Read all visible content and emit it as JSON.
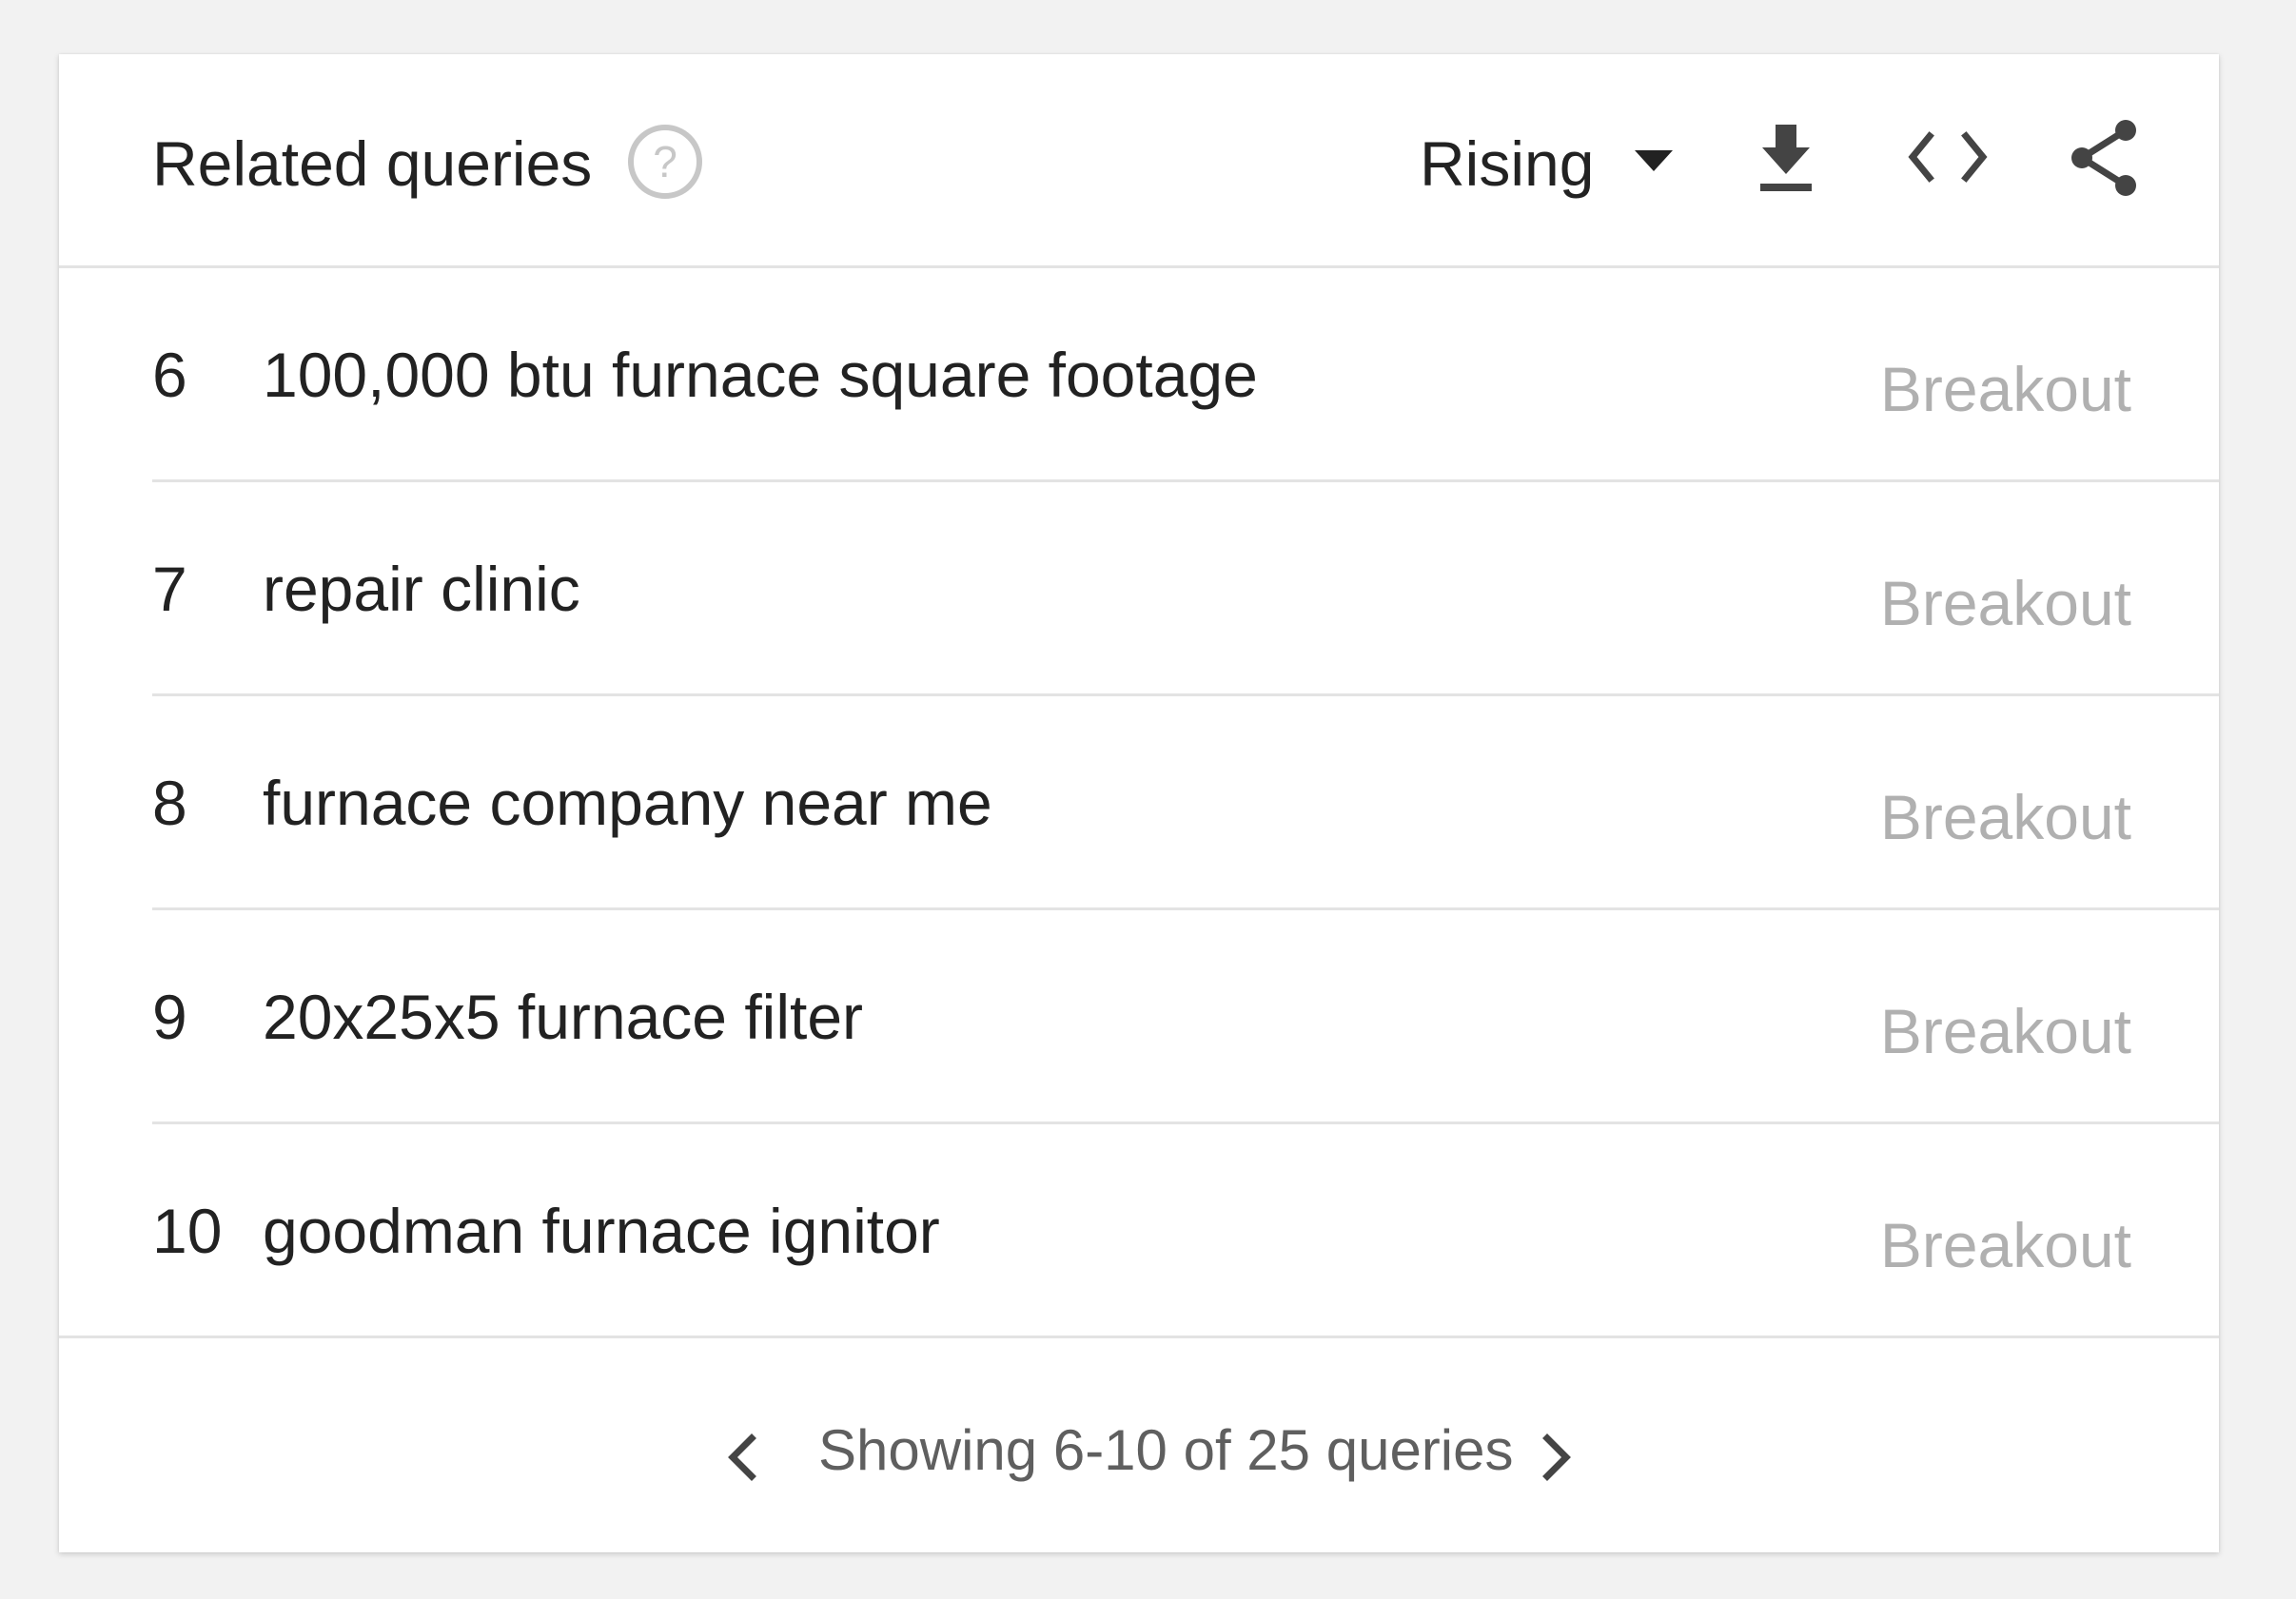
{
  "widget": {
    "title": "Related queries",
    "icons": {
      "help": "help-circle-icon",
      "dropdown": "caret-down-icon",
      "download": "download-icon",
      "embed": "code-embed-icon",
      "share": "share-icon",
      "prev": "chevron-left-icon",
      "next": "chevron-right-icon"
    },
    "filter": {
      "selected": "Rising"
    },
    "rows": [
      {
        "index": "6",
        "query": "100,000 btu furnace square footage",
        "value": "Breakout"
      },
      {
        "index": "7",
        "query": "repair clinic",
        "value": "Breakout"
      },
      {
        "index": "8",
        "query": "furnace company near me",
        "value": "Breakout"
      },
      {
        "index": "9",
        "query": "20x25x5 furnace filter",
        "value": "Breakout"
      },
      {
        "index": "10",
        "query": "goodman furnace ignitor",
        "value": "Breakout"
      }
    ],
    "pagination": {
      "status": "Showing 6-10 of 25 queries"
    }
  },
  "colors": {
    "background": "#f2f2f2",
    "card": "#ffffff",
    "text": "#222222",
    "muted": "#b0b0b0",
    "icon": "#444444",
    "divider": "#e3e3e3"
  }
}
